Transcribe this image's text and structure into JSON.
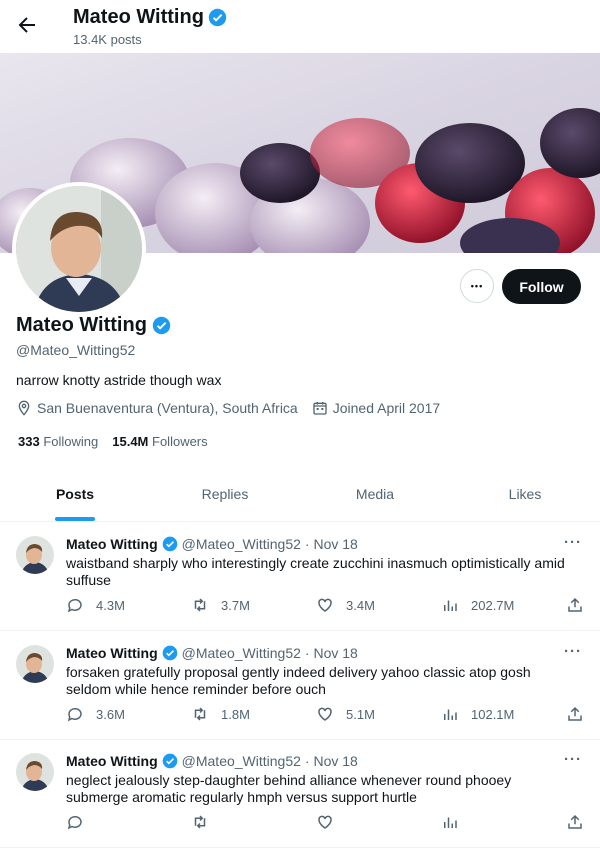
{
  "header": {
    "name": "Mateo Witting",
    "posts_count": "13.4K posts"
  },
  "profile": {
    "name": "Mateo Witting",
    "handle": "@Mateo_Witting52",
    "bio": "narrow knotty astride though wax",
    "location": "San Buenaventura (Ventura), South Africa",
    "joined": "Joined April 2017",
    "following_count": "333",
    "following_label": "Following",
    "followers_count": "15.4M",
    "followers_label": "Followers",
    "follow_button": "Follow",
    "more_button": "•••"
  },
  "tabs": [
    {
      "label": "Posts"
    },
    {
      "label": "Replies"
    },
    {
      "label": "Media"
    },
    {
      "label": "Likes"
    }
  ],
  "tweets": [
    {
      "name": "Mateo Witting",
      "handle": "@Mateo_Witting52",
      "date": "· Nov 18",
      "text": "waistband sharply who interestingly create zucchini inasmuch optimistically amid suffuse",
      "replies": "4.3M",
      "reposts": "3.7M",
      "likes": "3.4M",
      "views": "202.7M"
    },
    {
      "name": "Mateo Witting",
      "handle": "@Mateo_Witting52",
      "date": "· Nov 18",
      "text": "forsaken gratefully proposal gently indeed delivery yahoo classic atop gosh seldom while hence reminder before ouch",
      "replies": "3.6M",
      "reposts": "1.8M",
      "likes": "5.1M",
      "views": "102.1M"
    },
    {
      "name": "Mateo Witting",
      "handle": "@Mateo_Witting52",
      "date": "· Nov 18",
      "text": "neglect jealously step-daughter behind alliance whenever round phooey submerge aromatic regularly hmph versus support hurtle",
      "replies": "",
      "reposts": "",
      "likes": "",
      "views": ""
    }
  ],
  "colors": {
    "accent": "#1d9bf0",
    "text": "#0f1419",
    "muted": "#536471",
    "follow_bg": "#0f1419"
  },
  "icons": [
    "back-arrow-icon",
    "verified-badge-icon",
    "location-icon",
    "calendar-icon",
    "reply-icon",
    "repost-icon",
    "like-icon",
    "views-icon",
    "share-icon",
    "more-icon"
  ]
}
